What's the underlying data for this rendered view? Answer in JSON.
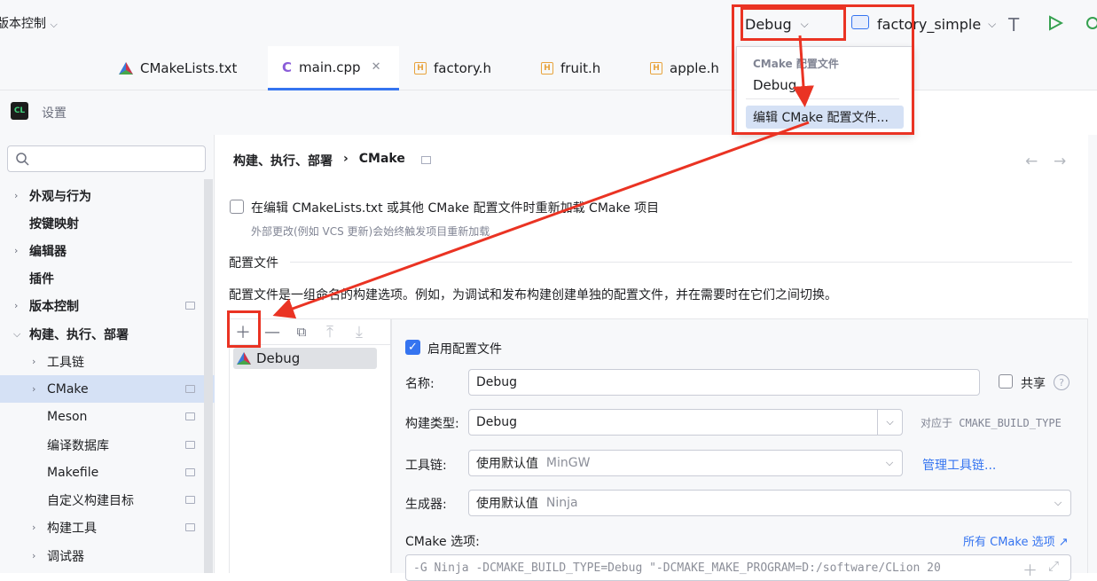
{
  "top": {
    "vcs_label": "版本控制",
    "config_select": "Debug",
    "run_config": "factory_simple"
  },
  "tabs": [
    {
      "label": "CMakeLists.txt"
    },
    {
      "label": "main.cpp"
    },
    {
      "label": "factory.h"
    },
    {
      "label": "fruit.h"
    },
    {
      "label": "apple.h"
    }
  ],
  "popup": {
    "section": "CMake 配置文件",
    "item": "Debug",
    "edit": "编辑 CMake 配置文件..."
  },
  "dialog": {
    "title": "设置",
    "breadcrumb_parent": "构建、执行、部署",
    "breadcrumb_sep": "›",
    "breadcrumb_current": "CMake"
  },
  "search": {
    "placeholder": ""
  },
  "sidebar": {
    "items": [
      {
        "label": "外观与行为"
      },
      {
        "label": "按键映射"
      },
      {
        "label": "编辑器"
      },
      {
        "label": "插件"
      },
      {
        "label": "版本控制"
      },
      {
        "label": "构建、执行、部署"
      },
      {
        "label": "工具链"
      },
      {
        "label": "CMake"
      },
      {
        "label": "Meson"
      },
      {
        "label": "编译数据库"
      },
      {
        "label": "Makefile"
      },
      {
        "label": "自定义构建目标"
      },
      {
        "label": "构建工具"
      },
      {
        "label": "调试器"
      }
    ]
  },
  "settings": {
    "reload_checkbox": "在编辑 CMakeLists.txt 或其他 CMake 配置文件时重新加载 CMake 项目",
    "reload_hint": "外部更改(例如 VCS 更新)会始终触发项目重新加载",
    "profiles_section": "配置文件",
    "profiles_desc": "配置文件是一组命名的构建选项。例如，为调试和发布构建创建单独的配置文件，并在需要时在它们之间切换。",
    "profile_list": [
      {
        "label": "Debug"
      }
    ],
    "enable_profile": "启用配置文件",
    "name_label": "名称:",
    "name_value": "Debug",
    "share_label": "共享",
    "build_type_label": "构建类型:",
    "build_type_value": "Debug",
    "build_type_hint": "对应于 CMAKE_BUILD_TYPE",
    "toolchain_label": "工具链:",
    "toolchain_value": "使用默认值",
    "toolchain_hint": "MinGW",
    "manage_toolchains": "管理工具链...",
    "generator_label": "生成器:",
    "generator_value": "使用默认值",
    "generator_hint": "Ninja",
    "cmake_options_label": "CMake 选项:",
    "all_cmake_options": "所有 CMake 选项 ↗",
    "cmake_options_value": "-G Ninja -DCMAKE_BUILD_TYPE=Debug \"-DCMAKE_MAKE_PROGRAM=D:/software/CLion 20"
  },
  "colors": {
    "accent": "#3574f0",
    "highlight": "#ea3323"
  }
}
